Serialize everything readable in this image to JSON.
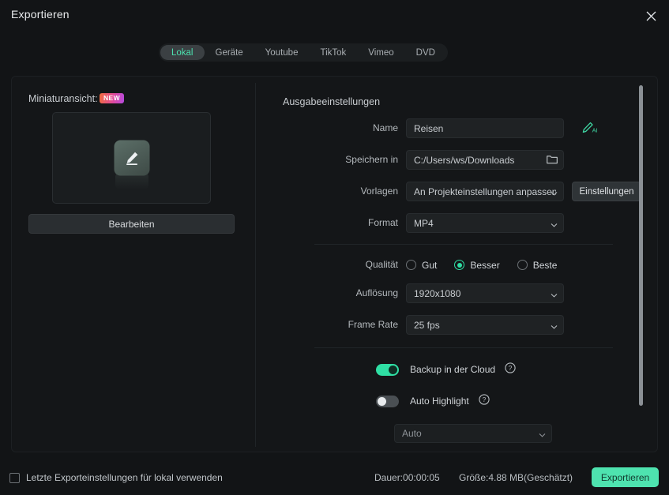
{
  "window": {
    "title": "Exportieren",
    "close_icon": "close-icon"
  },
  "tabs": [
    {
      "label": "Lokal",
      "active": true
    },
    {
      "label": "Geräte",
      "active": false
    },
    {
      "label": "Youtube",
      "active": false
    },
    {
      "label": "TikTok",
      "active": false
    },
    {
      "label": "Vimeo",
      "active": false
    },
    {
      "label": "DVD",
      "active": false
    }
  ],
  "thumbnail_panel": {
    "label": "Miniaturansicht:",
    "badge": "NEW",
    "preview_icon": "pencil-edit-icon",
    "edit_button": "Bearbeiten"
  },
  "output_settings": {
    "section_title": "Ausgabeeinstellungen",
    "name": {
      "label": "Name",
      "value": "Reisen",
      "ai_icon": "ai-pen-icon"
    },
    "save_to": {
      "label": "Speichern in",
      "value": "C:/Users/ws/Downloads",
      "folder_icon": "folder-icon"
    },
    "templates": {
      "label": "Vorlagen",
      "value": "An Projekteinstellungen anpassen",
      "settings_button": "Einstellungen"
    },
    "format": {
      "label": "Format",
      "value": "MP4"
    },
    "quality": {
      "label": "Qualität",
      "options": [
        {
          "label": "Gut",
          "selected": false
        },
        {
          "label": "Besser",
          "selected": true
        },
        {
          "label": "Beste",
          "selected": false
        }
      ]
    },
    "resolution": {
      "label": "Auflösung",
      "value": "1920x1080"
    },
    "frame_rate": {
      "label": "Frame Rate",
      "value": "25 fps"
    },
    "cloud_backup": {
      "label": "Backup in der Cloud",
      "on": true,
      "help_icon": "help-circle-icon"
    },
    "auto_highlight": {
      "label": "Auto Highlight",
      "on": false,
      "help_icon": "help-circle-icon"
    },
    "partial_dropdown": {
      "value": "Auto"
    }
  },
  "footer": {
    "remember_label": "Letzte Exporteinstellungen für lokal verwenden",
    "duration": "Dauer:00:00:05",
    "size": "Größe:4.88 MB(Geschätzt)",
    "export_button": "Exportieren"
  },
  "colors": {
    "accent_green": "#2fdfa4",
    "export_green": "#4ee3af",
    "badge_gradient_start": "#f26d3d",
    "badge_gradient_end": "#b44ae0",
    "background": "#121416"
  }
}
